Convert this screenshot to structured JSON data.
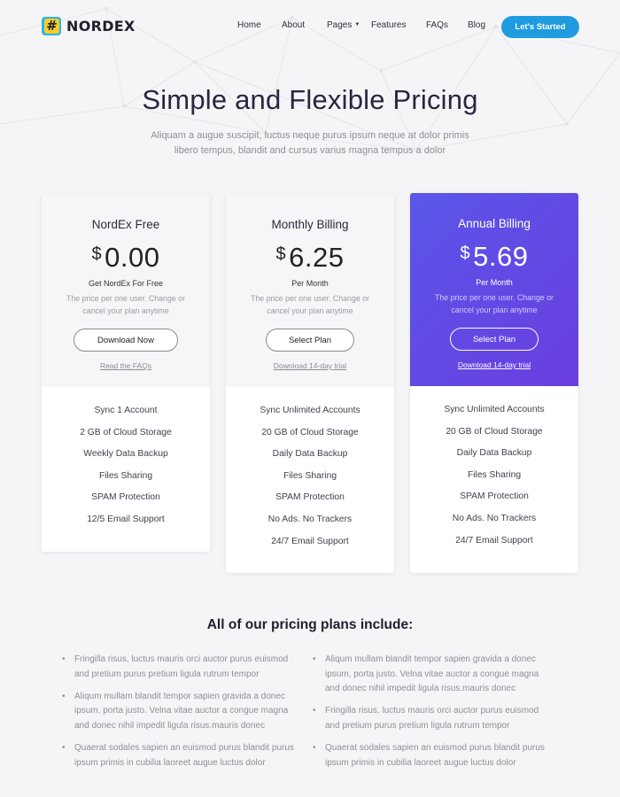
{
  "header": {
    "logo_glyph": "#",
    "logo_text": "NORDEX",
    "nav": [
      "Home",
      "About",
      "Pages",
      "Features",
      "FAQs",
      "Blog"
    ],
    "cta_label": "Let's Started"
  },
  "hero": {
    "title": "Simple and Flexible Pricing",
    "subtitle": "Aliquam a augue suscipit, luctus neque purus ipsum neque at dolor primis libero tempus, blandit and cursus varius magna tempus a dolor"
  },
  "plans": [
    {
      "name": "NordEx Free",
      "currency": "$",
      "price": "0.00",
      "period": "Get NordEx For Free",
      "description": "The price per one user. Change or cancel your plan anytime",
      "button": "Download Now",
      "link": "Read the FAQs",
      "features": [
        "Sync 1 Account",
        "2 GB of Cloud Storage",
        "Weekly Data Backup",
        "Files Sharing",
        "SPAM Protection",
        "12/5 Email Support"
      ]
    },
    {
      "name": "Monthly Billing",
      "currency": "$",
      "price": "6.25",
      "period": "Per Month",
      "description": "The price per one user. Change or cancel your plan anytime",
      "button": "Select Plan",
      "link": "Download 14-day trial",
      "features": [
        "Sync Unlimited Accounts",
        "20 GB of Cloud Storage",
        "Daily Data Backup",
        "Files Sharing",
        "SPAM Protection",
        "No Ads. No Trackers",
        "24/7 Email Support"
      ]
    },
    {
      "name": "Annual Billing",
      "currency": "$",
      "price": "5.69",
      "period": "Per Month",
      "description": "The price per one user. Change or cancel your plan anytime",
      "button": "Select Plan",
      "link": "Download 14-day trial",
      "features": [
        "Sync Unlimited Accounts",
        "20 GB of Cloud Storage",
        "Daily Data Backup",
        "Files Sharing",
        "SPAM Protection",
        "No Ads. No Trackers",
        "24/7 Email Support"
      ]
    }
  ],
  "includes": {
    "title": "All of our pricing plans include:",
    "left": [
      "Fringilla risus, luctus mauris orci auctor purus euismod and pretium purus pretium ligula rutrum tempor",
      "Aliqum mullam blandit tempor sapien gravida a donec ipsum, porta justo. Velna vitae auctor a congue magna and donec nihil impedit ligula risus.mauris donec",
      "Quaerat sodales sapien an euismod purus blandit purus ipsum primis in cubilia laoreet augue luctus dolor"
    ],
    "right": [
      "Aliqum mullam blandit tempor sapien gravida a donec ipsum, porta justo. Velna vitae auctor a congue magna and donec nihil impedit ligula risus.mauris donec",
      "Fringilla risus, luctus mauris orci auctor purus euismod and pretium purus pretium ligula rutrum tempor",
      "Quaerat sodales sapien an euismod purus blandit purus ipsum primis in cubilia laoreet augue luctus dolor"
    ]
  },
  "colors": {
    "accent": "#1f9be0",
    "featured_gradient_start": "#5a56e8",
    "featured_gradient_end": "#6a3ee0",
    "logo_blue": "#2bb4e8",
    "logo_yellow": "#f5cd2a"
  }
}
